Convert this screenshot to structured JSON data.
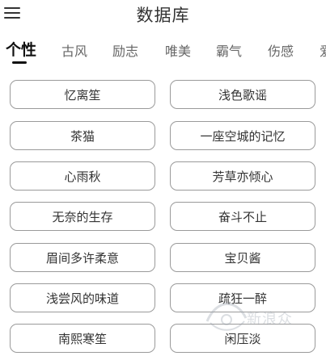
{
  "header": {
    "title": "数据库",
    "menu_icon": "hamburger-menu-icon"
  },
  "tabs": [
    {
      "label": "个性",
      "active": true
    },
    {
      "label": "古风",
      "active": false
    },
    {
      "label": "励志",
      "active": false
    },
    {
      "label": "唯美",
      "active": false
    },
    {
      "label": "霸气",
      "active": false
    },
    {
      "label": "伤感",
      "active": false
    },
    {
      "label": "爱",
      "active": false
    }
  ],
  "items": [
    "忆离笙",
    "浅色歌谣",
    "茶猫",
    "一座空城的记忆",
    "心雨秋",
    "芳草亦倾心",
    "无奈的生存",
    "奋斗不止",
    "眉间多许柔意",
    "宝贝酱",
    "浅尝风的味道",
    "疏狂一醉",
    "南熙寒笙",
    "闲压淡"
  ],
  "watermark": {
    "text": "新浪众"
  }
}
